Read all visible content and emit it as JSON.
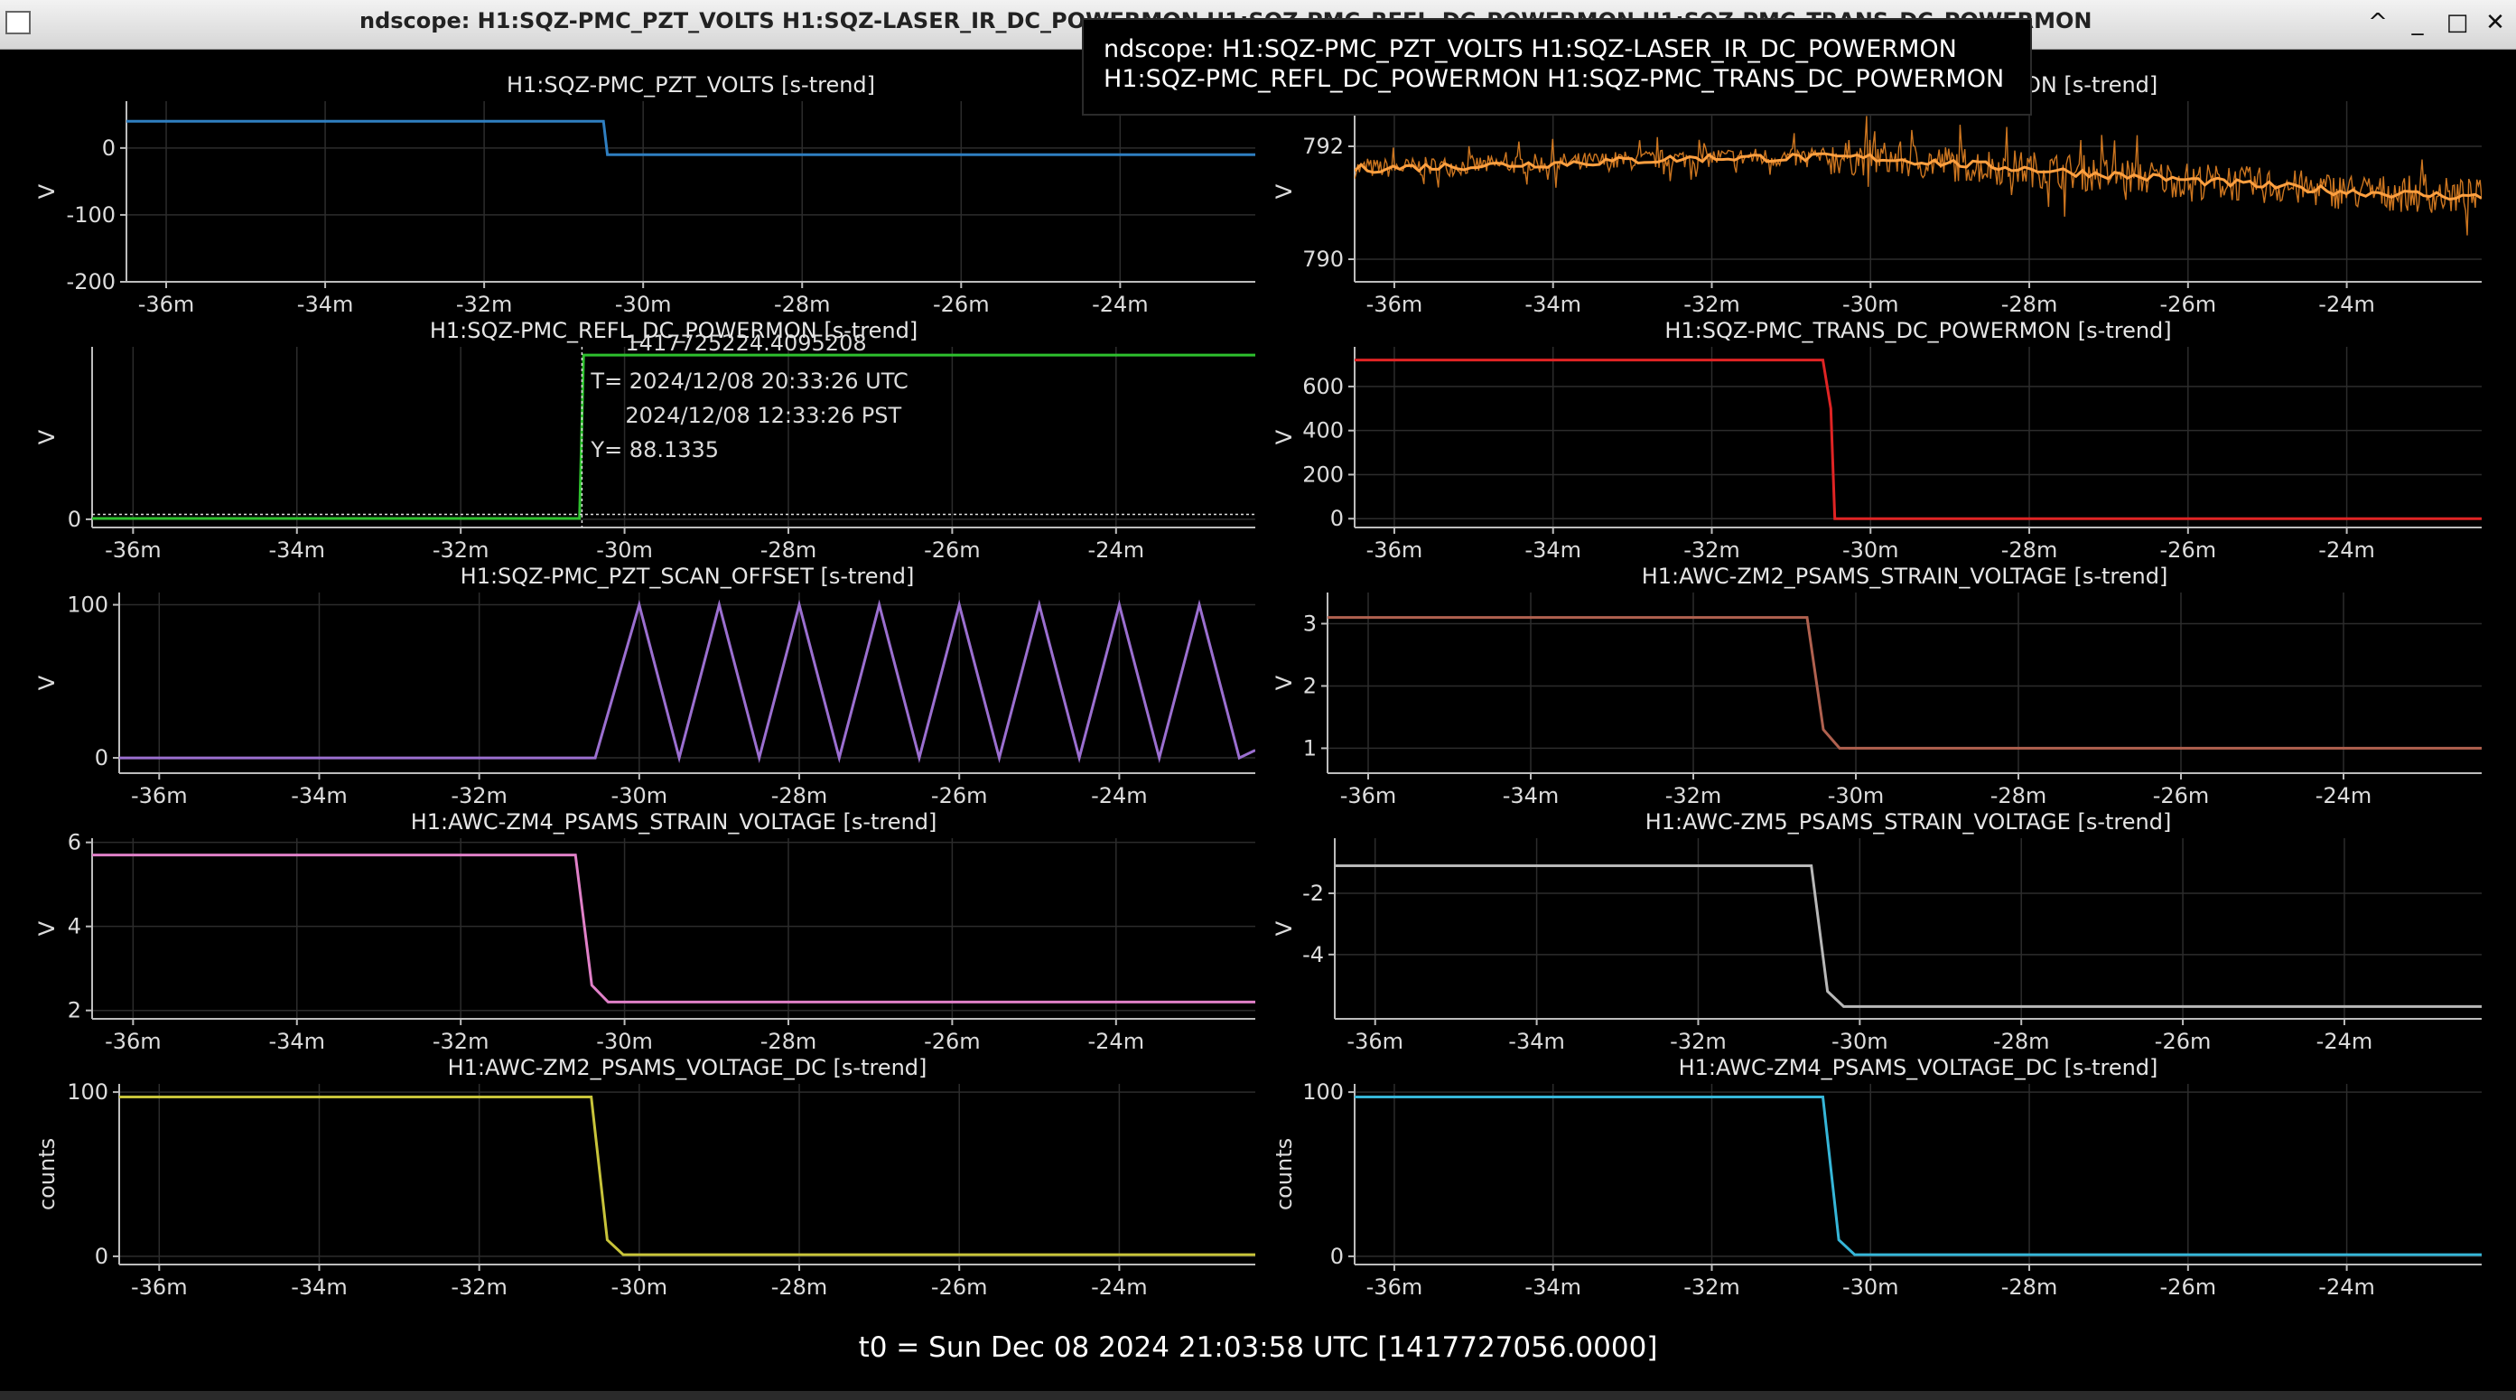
{
  "window": {
    "title": "ndscope: H1:SQZ-PMC_PZT_VOLTS H1:SQZ-LASER_IR_DC_POWERMON H1:SQZ-PMC_REFL_DC_POWERMON H1:SQZ-PMC_TRANS_DC_POWERMON",
    "controls": [
      "^",
      "_",
      "□",
      "✕"
    ]
  },
  "tooltip": "ndscope: H1:SQZ-PMC_PZT_VOLTS H1:SQZ-LASER_IR_DC_POWERMON H1:SQZ-PMC_REFL_DC_POWERMON H1:SQZ-PMC_TRANS_DC_POWERMON",
  "cursor": {
    "gps": "1417725224.4095208",
    "t_utc": "T= 2024/12/08 20:33:26 UTC",
    "t_pst": "2024/12/08 12:33:26 PST",
    "y": "Y= 88.1335"
  },
  "t0": "t0 = Sun Dec 08 2024 21:03:58 UTC [1417727056.0000]",
  "chart_data": [
    {
      "type": "line",
      "title": "H1:SQZ-PMC_PZT_VOLTS [s-trend]",
      "ylabel": "V",
      "color": "#2f7fc1",
      "x_ticks": [
        "-36m",
        "-34m",
        "-32m",
        "-30m",
        "-28m",
        "-26m",
        "-24m"
      ],
      "y_ticks": [
        0,
        -100,
        -200
      ],
      "xlim": [
        -36.5,
        -22.3
      ],
      "ylim": [
        -200,
        70
      ],
      "series": [
        {
          "x": [
            -36.5,
            -30.5,
            -30.45,
            -22.3
          ],
          "y": [
            40,
            40,
            -10,
            -10
          ],
          "noise": 0
        }
      ]
    },
    {
      "type": "line",
      "title": "H1:SQZ-LASER_IR_DC_POWERMON [s-trend]",
      "ylabel": "V",
      "color": "#f08a24",
      "x_ticks": [
        "-36m",
        "-34m",
        "-32m",
        "-30m",
        "-28m",
        "-26m",
        "-24m"
      ],
      "y_ticks": [
        792,
        790
      ],
      "xlim": [
        -36.5,
        -22.3
      ],
      "ylim": [
        789.6,
        792.8
      ],
      "series": [
        {
          "x": [
            -36.5,
            -34,
            -32,
            -30,
            -28,
            -26,
            -24,
            -22.3
          ],
          "y": [
            791.6,
            791.7,
            791.8,
            791.8,
            791.6,
            791.4,
            791.2,
            791.1
          ],
          "noise": 0.5
        }
      ]
    },
    {
      "type": "line",
      "title": "H1:SQZ-PMC_REFL_DC_POWERMON [s-trend]",
      "ylabel": "V",
      "color": "#2ec02e",
      "x_ticks": [
        "-36m",
        "-34m",
        "-32m",
        "-30m",
        "-28m",
        "-26m",
        "-24m"
      ],
      "y_ticks": [
        0
      ],
      "xlim": [
        -36.5,
        -22.3
      ],
      "ylim": [
        -5,
        105
      ],
      "series": [
        {
          "x": [
            -36.5,
            -30.55,
            -30.5,
            -22.3
          ],
          "y": [
            0.5,
            0.5,
            100,
            100
          ],
          "noise": 0
        }
      ]
    },
    {
      "type": "line",
      "title": "H1:SQZ-PMC_TRANS_DC_POWERMON [s-trend]",
      "ylabel": "V",
      "color": "#e02424",
      "x_ticks": [
        "-36m",
        "-34m",
        "-32m",
        "-30m",
        "-28m",
        "-26m",
        "-24m"
      ],
      "y_ticks": [
        600,
        400,
        200,
        0
      ],
      "xlim": [
        -36.5,
        -22.3
      ],
      "ylim": [
        -40,
        780
      ],
      "series": [
        {
          "x": [
            -36.5,
            -30.6,
            -30.5,
            -30.45,
            -22.3
          ],
          "y": [
            720,
            720,
            500,
            0,
            0
          ],
          "noise": 0
        }
      ]
    },
    {
      "type": "line",
      "title": "H1:SQZ-PMC_PZT_SCAN_OFFSET [s-trend]",
      "ylabel": "V",
      "color": "#9b6fd0",
      "x_ticks": [
        "-36m",
        "-34m",
        "-32m",
        "-30m",
        "-28m",
        "-26m",
        "-24m"
      ],
      "y_ticks": [
        100,
        0
      ],
      "xlim": [
        -36.5,
        -22.3
      ],
      "ylim": [
        -10,
        108
      ],
      "series": [
        {
          "x": [
            -36.5,
            -30.55,
            -30,
            -29.5,
            -29,
            -28.5,
            -28,
            -27.5,
            -27,
            -26.5,
            -26,
            -25.5,
            -25,
            -24.5,
            -24,
            -23.5,
            -23,
            -22.5,
            -22.3
          ],
          "y": [
            0,
            0,
            100,
            0,
            100,
            0,
            100,
            0,
            100,
            0,
            100,
            0,
            100,
            0,
            100,
            0,
            100,
            0,
            5
          ],
          "noise": 0
        }
      ]
    },
    {
      "type": "line",
      "title": "H1:AWC-ZM2_PSAMS_STRAIN_VOLTAGE [s-trend]",
      "ylabel": "V",
      "color": "#b0614f",
      "x_ticks": [
        "-36m",
        "-34m",
        "-32m",
        "-30m",
        "-28m",
        "-26m",
        "-24m"
      ],
      "y_ticks": [
        3,
        2,
        1
      ],
      "xlim": [
        -36.5,
        -22.3
      ],
      "ylim": [
        0.6,
        3.5
      ],
      "series": [
        {
          "x": [
            -36.5,
            -30.6,
            -30.4,
            -30.2,
            -22.3
          ],
          "y": [
            3.1,
            3.1,
            1.3,
            1.0,
            1.0
          ],
          "noise": 0
        }
      ]
    },
    {
      "type": "line",
      "title": "H1:AWC-ZM4_PSAMS_STRAIN_VOLTAGE [s-trend]",
      "ylabel": "V",
      "color": "#e080c8",
      "x_ticks": [
        "-36m",
        "-34m",
        "-32m",
        "-30m",
        "-28m",
        "-26m",
        "-24m"
      ],
      "y_ticks": [
        6,
        4,
        2
      ],
      "xlim": [
        -36.5,
        -22.3
      ],
      "ylim": [
        1.8,
        6.1
      ],
      "series": [
        {
          "x": [
            -36.5,
            -30.6,
            -30.4,
            -30.2,
            -22.3
          ],
          "y": [
            5.7,
            5.7,
            2.6,
            2.2,
            2.2
          ],
          "noise": 0
        }
      ]
    },
    {
      "type": "line",
      "title": "H1:AWC-ZM5_PSAMS_STRAIN_VOLTAGE [s-trend]",
      "ylabel": "V",
      "color": "#b8b8b8",
      "x_ticks": [
        "-36m",
        "-34m",
        "-32m",
        "-30m",
        "-28m",
        "-26m",
        "-24m"
      ],
      "y_ticks": [
        -2,
        -4
      ],
      "xlim": [
        -36.5,
        -22.3
      ],
      "ylim": [
        -6.1,
        -0.2
      ],
      "series": [
        {
          "x": [
            -36.5,
            -30.6,
            -30.4,
            -30.2,
            -22.3
          ],
          "y": [
            -1.1,
            -1.1,
            -5.2,
            -5.7,
            -5.7
          ],
          "noise": 0
        }
      ]
    },
    {
      "type": "line",
      "title": "H1:AWC-ZM2_PSAMS_VOLTAGE_DC [s-trend]",
      "ylabel": "counts",
      "color": "#c8c43a",
      "x_ticks": [
        "-36m",
        "-34m",
        "-32m",
        "-30m",
        "-28m",
        "-26m",
        "-24m"
      ],
      "y_ticks": [
        100,
        0
      ],
      "xlim": [
        -36.5,
        -22.3
      ],
      "ylim": [
        -5,
        105
      ],
      "series": [
        {
          "x": [
            -36.5,
            -30.6,
            -30.4,
            -30.2,
            -22.3
          ],
          "y": [
            97,
            97,
            10,
            1,
            1
          ],
          "noise": 0
        }
      ]
    },
    {
      "type": "line",
      "title": "H1:AWC-ZM4_PSAMS_VOLTAGE_DC [s-trend]",
      "ylabel": "counts",
      "color": "#36b6d8",
      "x_ticks": [
        "-36m",
        "-34m",
        "-32m",
        "-30m",
        "-28m",
        "-26m",
        "-24m"
      ],
      "y_ticks": [
        100,
        0
      ],
      "xlim": [
        -36.5,
        -22.3
      ],
      "ylim": [
        -5,
        105
      ],
      "series": [
        {
          "x": [
            -36.5,
            -30.6,
            -30.4,
            -30.2,
            -22.3
          ],
          "y": [
            97,
            97,
            10,
            1,
            1
          ],
          "noise": 0
        }
      ]
    }
  ]
}
